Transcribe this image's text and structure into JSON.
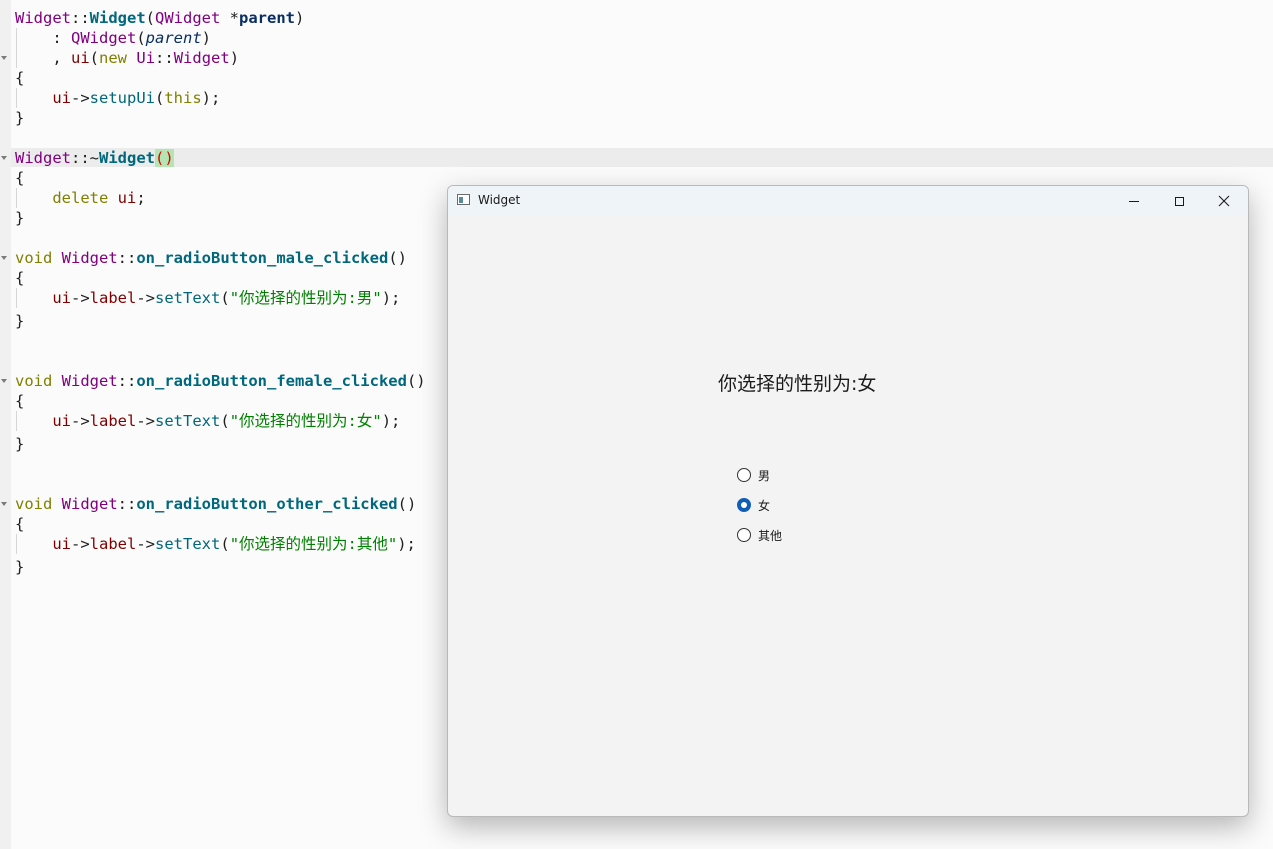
{
  "editor": {
    "lines": [
      [
        [
          "ty",
          "Widget"
        ],
        [
          "op",
          "::"
        ],
        [
          "fn",
          "Widget"
        ],
        [
          "op",
          "("
        ],
        [
          "ty",
          "QWidget"
        ],
        [
          "op",
          " *"
        ],
        [
          "par",
          "parent"
        ],
        [
          "op",
          ")"
        ]
      ],
      [
        [
          "op",
          "    : "
        ],
        [
          "ty",
          "QWidget"
        ],
        [
          "op",
          "("
        ],
        [
          "it",
          "parent"
        ],
        [
          "op",
          ")"
        ]
      ],
      [
        [
          "op",
          "    , "
        ],
        [
          "mem",
          "ui"
        ],
        [
          "op",
          "("
        ],
        [
          "kw",
          "new"
        ],
        [
          "op",
          " "
        ],
        [
          "ty",
          "Ui"
        ],
        [
          "op",
          "::"
        ],
        [
          "ty",
          "Widget"
        ],
        [
          "op",
          ")"
        ]
      ],
      [
        [
          "op",
          "{"
        ]
      ],
      [
        [
          "op",
          "    "
        ],
        [
          "mem",
          "ui"
        ],
        [
          "op",
          "->"
        ],
        [
          "fnn",
          "setupUi"
        ],
        [
          "op",
          "("
        ],
        [
          "kw",
          "this"
        ],
        [
          "op",
          ");"
        ]
      ],
      [
        [
          "op",
          "}"
        ]
      ],
      [
        [
          "op",
          ""
        ]
      ],
      [
        [
          "ty",
          "Widget"
        ],
        [
          "op",
          "::~"
        ],
        [
          "fn",
          "Widget"
        ],
        [
          "hl",
          "()"
        ]
      ],
      [
        [
          "op",
          "{"
        ]
      ],
      [
        [
          "op",
          "    "
        ],
        [
          "kw",
          "delete"
        ],
        [
          "op",
          " "
        ],
        [
          "mem",
          "ui"
        ],
        [
          "op",
          ";"
        ]
      ],
      [
        [
          "op",
          "}"
        ]
      ],
      [
        [
          "op",
          ""
        ]
      ],
      [
        [
          "kw",
          "void"
        ],
        [
          "op",
          " "
        ],
        [
          "ty",
          "Widget"
        ],
        [
          "op",
          "::"
        ],
        [
          "fn",
          "on_radioButton_male_clicked"
        ],
        [
          "op",
          "()"
        ]
      ],
      [
        [
          "op",
          "{"
        ]
      ],
      [
        [
          "op",
          "    "
        ],
        [
          "mem",
          "ui"
        ],
        [
          "op",
          "->"
        ],
        [
          "mem",
          "label"
        ],
        [
          "op",
          "->"
        ],
        [
          "fnn",
          "setText"
        ],
        [
          "op",
          "("
        ],
        [
          "str",
          "\"你选择的性别为:男\""
        ],
        [
          "op",
          ");"
        ]
      ],
      [
        [
          "op",
          "}"
        ]
      ],
      [
        [
          "op",
          ""
        ]
      ],
      [
        [
          "op",
          ""
        ]
      ],
      [
        [
          "kw",
          "void"
        ],
        [
          "op",
          " "
        ],
        [
          "ty",
          "Widget"
        ],
        [
          "op",
          "::"
        ],
        [
          "fn",
          "on_radioButton_female_clicked"
        ],
        [
          "op",
          "()"
        ]
      ],
      [
        [
          "op",
          "{"
        ]
      ],
      [
        [
          "op",
          "    "
        ],
        [
          "mem",
          "ui"
        ],
        [
          "op",
          "->"
        ],
        [
          "mem",
          "label"
        ],
        [
          "op",
          "->"
        ],
        [
          "fnn",
          "setText"
        ],
        [
          "op",
          "("
        ],
        [
          "str",
          "\"你选择的性别为:女\""
        ],
        [
          "op",
          ");"
        ]
      ],
      [
        [
          "op",
          "}"
        ]
      ],
      [
        [
          "op",
          ""
        ]
      ],
      [
        [
          "op",
          ""
        ]
      ],
      [
        [
          "kw",
          "void"
        ],
        [
          "op",
          " "
        ],
        [
          "ty",
          "Widget"
        ],
        [
          "op",
          "::"
        ],
        [
          "fn",
          "on_radioButton_other_clicked"
        ],
        [
          "op",
          "()"
        ]
      ],
      [
        [
          "op",
          "{"
        ]
      ],
      [
        [
          "op",
          "    "
        ],
        [
          "mem",
          "ui"
        ],
        [
          "op",
          "->"
        ],
        [
          "mem",
          "label"
        ],
        [
          "op",
          "->"
        ],
        [
          "fnn",
          "setText"
        ],
        [
          "op",
          "("
        ],
        [
          "str",
          "\"你选择的性别为:其他\""
        ],
        [
          "op",
          ");"
        ]
      ],
      [
        [
          "op",
          "}"
        ]
      ]
    ],
    "line_positions": [
      0,
      20,
      40,
      60,
      80,
      100,
      120,
      140,
      160,
      180,
      200,
      220,
      240,
      260,
      280,
      303,
      323,
      343,
      363,
      383,
      403,
      426,
      446,
      466,
      486,
      506,
      526,
      549
    ]
  },
  "window": {
    "title": "Widget",
    "minimize": "minimize",
    "maximize": "maximize",
    "close": "close",
    "result_label": "你选择的性别为:女",
    "options": [
      {
        "label": "男",
        "checked": false
      },
      {
        "label": "女",
        "checked": true
      },
      {
        "label": "其他",
        "checked": false
      }
    ]
  }
}
